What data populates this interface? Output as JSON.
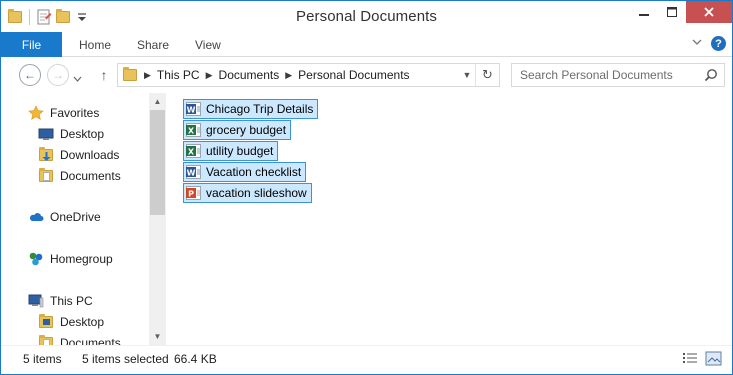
{
  "window": {
    "title": "Personal Documents",
    "controls": {
      "minimize": "—",
      "maximize": "☐",
      "close": "✕"
    }
  },
  "ribbon": {
    "tabs": [
      {
        "label": "File"
      },
      {
        "label": "Home"
      },
      {
        "label": "Share"
      },
      {
        "label": "View"
      }
    ],
    "help": "?"
  },
  "nav": {
    "back": "←",
    "forward": "→",
    "up": "↑",
    "breadcrumb": [
      "This PC",
      "Documents",
      "Personal Documents"
    ],
    "refresh": "↻"
  },
  "search": {
    "placeholder": "Search Personal Documents",
    "value": ""
  },
  "navpane": {
    "items": [
      {
        "label": "Favorites",
        "icon": "star-icon"
      },
      {
        "label": "Desktop",
        "icon": "desktop-icon"
      },
      {
        "label": "Downloads",
        "icon": "downloads-folder-icon"
      },
      {
        "label": "Documents",
        "icon": "documents-folder-icon"
      },
      {
        "label": "OneDrive",
        "icon": "onedrive-cloud-icon"
      },
      {
        "label": "Homegroup",
        "icon": "homegroup-icon"
      },
      {
        "label": "This PC",
        "icon": "computer-icon"
      },
      {
        "label": "Desktop",
        "icon": "folder-icon"
      },
      {
        "label": "Documents",
        "icon": "folder-icon"
      }
    ]
  },
  "files": [
    {
      "name": "Chicago Trip Details",
      "type": "word",
      "icon": "word-document-icon",
      "color": "#2b579a",
      "letter": "W"
    },
    {
      "name": "grocery budget",
      "type": "excel",
      "icon": "excel-workbook-icon",
      "color": "#217346",
      "letter": "X"
    },
    {
      "name": "utility budget",
      "type": "excel",
      "icon": "excel-workbook-icon",
      "color": "#217346",
      "letter": "X"
    },
    {
      "name": "Vacation checklist",
      "type": "word",
      "icon": "word-document-icon",
      "color": "#2b579a",
      "letter": "W"
    },
    {
      "name": "vacation slideshow",
      "type": "powerpoint",
      "icon": "powerpoint-presentation-icon",
      "color": "#d24726",
      "letter": "P"
    }
  ],
  "status": {
    "item_count": "5 items",
    "selected": "5 items selected",
    "size": "66.4 KB"
  },
  "colors": {
    "accent": "#1979ca",
    "selection_fill": "#cce8ff",
    "selection_border": "#3c93d8",
    "close_button": "#c75050"
  }
}
